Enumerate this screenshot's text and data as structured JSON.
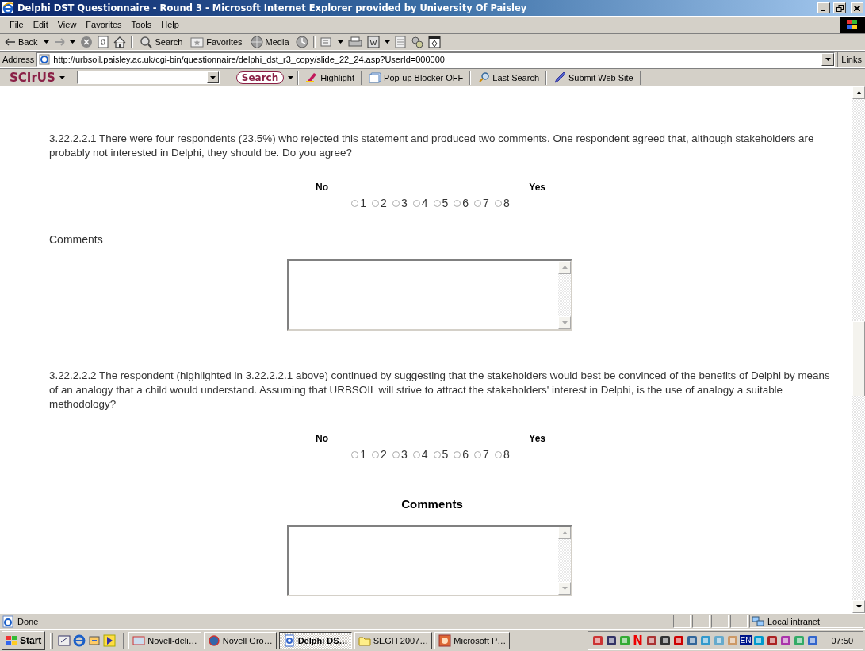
{
  "window": {
    "title": "Delphi DST Questionnaire - Round 3 - Microsoft Internet Explorer provided by University Of Paisley"
  },
  "menu": [
    "File",
    "Edit",
    "View",
    "Favorites",
    "Tools",
    "Help"
  ],
  "toolbar": {
    "back": "Back",
    "search": "Search",
    "favorites": "Favorites",
    "media": "Media"
  },
  "address": {
    "label": "Address",
    "value": "http://urbsoil.paisley.ac.uk/cgi-bin/questionnaire/delphi_dst_r3_copy/slide_22_24.asp?UserId=000000",
    "links": "Links"
  },
  "scirus": {
    "logo": "SCIrUS",
    "search": "Search",
    "buttons": [
      "Highlight",
      "Pop-up Blocker OFF",
      "Last Search",
      "Submit Web Site"
    ]
  },
  "questions": [
    {
      "text": "3.22.2.2.1 There were four respondents (23.5%) who rejected this statement and produced two comments. One respondent agreed that, although stakeholders are probably not interested in Delphi, they should be. Do you agree?",
      "low": "No",
      "high": "Yes",
      "options": [
        {
          "label": "1",
          "selected": false
        },
        {
          "label": "2",
          "selected": false
        },
        {
          "label": "3",
          "selected": false
        },
        {
          "label": "4",
          "selected": false
        },
        {
          "label": "5",
          "selected": false
        },
        {
          "label": "6",
          "selected": false
        },
        {
          "label": "7",
          "selected": false
        },
        {
          "label": "8",
          "selected": false
        }
      ],
      "comments": {
        "kind": "plain",
        "label": "Comments"
      }
    },
    {
      "text": "3.22.2.2.2 The respondent (highlighted in 3.22.2.2.1 above) continued by suggesting that the stakeholders would best be convinced of the benefits of Delphi by means of an analogy that a child would understand. Assuming that URBSOIL will strive to attract the stakeholders' interest in Delphi, is the use of analogy a suitable methodology?",
      "low": "No",
      "high": "Yes",
      "options": [
        {
          "label": "1",
          "selected": false
        },
        {
          "label": "2",
          "selected": false
        },
        {
          "label": "3",
          "selected": false
        },
        {
          "label": "4",
          "selected": false
        },
        {
          "label": "5",
          "selected": false
        },
        {
          "label": "6",
          "selected": false
        },
        {
          "label": "7",
          "selected": false
        },
        {
          "label": "8",
          "selected": false
        }
      ],
      "comments": {
        "kind": "heading",
        "label": "Comments"
      }
    }
  ],
  "status_bar": {
    "text": "Done",
    "zone": "Local intranet"
  },
  "taskbar": {
    "start": "Start",
    "tasks": [
      {
        "label": "Novell-deli…",
        "selected": false
      },
      {
        "label": "Novell Gro…",
        "selected": false
      },
      {
        "label": "Delphi DS…",
        "selected": true
      },
      {
        "label": "SEGH 2007…",
        "selected": false
      },
      {
        "label": "Microsoft P…",
        "selected": false
      }
    ],
    "tray": [
      {
        "kind": "icon"
      },
      {
        "kind": "icon"
      },
      {
        "kind": "icon"
      },
      {
        "kind": "text",
        "text": "N"
      },
      {
        "kind": "icon"
      },
      {
        "kind": "icon"
      },
      {
        "kind": "icon"
      },
      {
        "kind": "icon"
      },
      {
        "kind": "icon"
      },
      {
        "kind": "icon"
      },
      {
        "kind": "icon"
      },
      {
        "kind": "text",
        "text": "EN"
      },
      {
        "kind": "icon"
      },
      {
        "kind": "icon"
      },
      {
        "kind": "icon"
      },
      {
        "kind": "icon"
      },
      {
        "kind": "icon"
      }
    ],
    "clock": "07:50"
  }
}
